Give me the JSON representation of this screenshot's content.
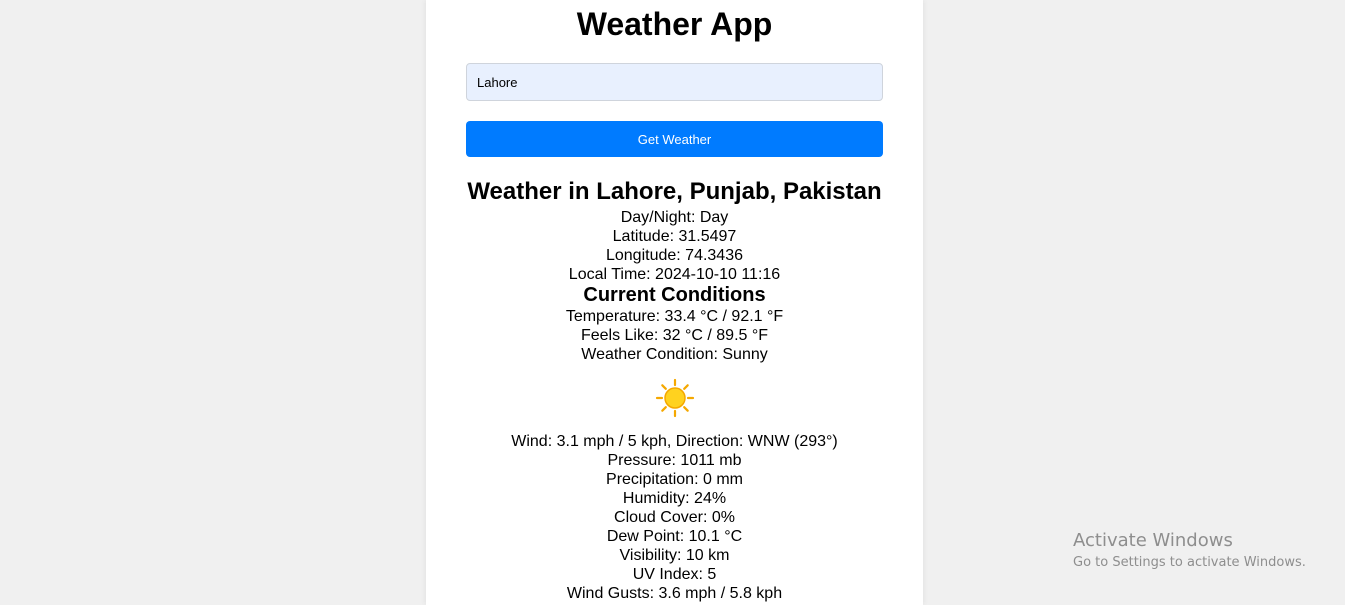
{
  "app": {
    "title": "Weather App"
  },
  "search": {
    "value": "Lahore",
    "button_label": "Get Weather"
  },
  "location": {
    "heading": "Weather in Lahore, Punjab, Pakistan",
    "day_night": "Day/Night: Day",
    "latitude": "Latitude: 31.5497",
    "longitude": "Longitude: 74.3436",
    "local_time": "Local Time: 2024-10-10 11:16"
  },
  "current": {
    "heading": "Current Conditions",
    "temperature": "Temperature: 33.4 °C / 92.1 °F",
    "feels_like": "Feels Like: 32 °C / 89.5 °F",
    "condition": "Weather Condition: Sunny",
    "condition_icon": "sun-icon",
    "wind": "Wind: 3.1 mph / 5 kph, Direction: WNW (293°)",
    "pressure": "Pressure: 1011 mb",
    "precipitation": "Precipitation: 0 mm",
    "humidity": "Humidity: 24%",
    "cloud_cover": "Cloud Cover: 0%",
    "dew_point": "Dew Point: 10.1 °C",
    "visibility": "Visibility: 10 km",
    "uv_index": "UV Index: 5",
    "wind_gusts": "Wind Gusts: 3.6 mph / 5.8 kph"
  },
  "watermark": {
    "title": "Activate Windows",
    "subtitle": "Go to Settings to activate Windows."
  },
  "colors": {
    "button": "#007bff",
    "input_bg": "#e8f0fe",
    "page_bg": "#f0f0f0",
    "sun": "#ffc107"
  }
}
